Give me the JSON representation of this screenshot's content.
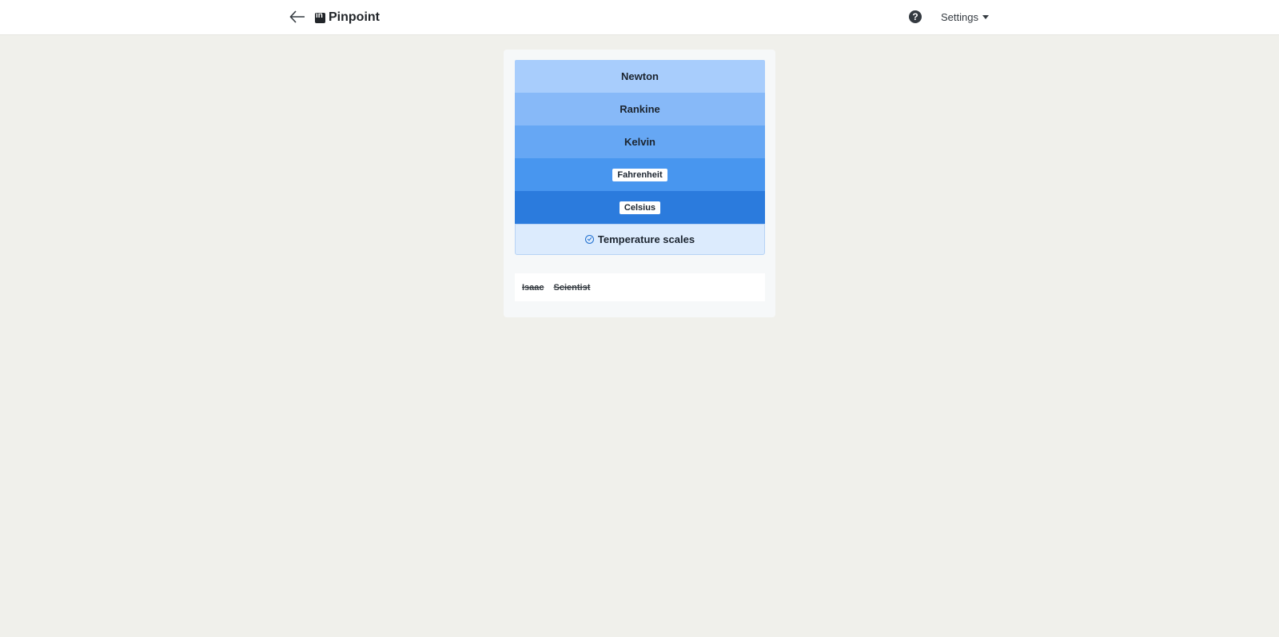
{
  "header": {
    "brand_name": "Pinpoint",
    "settings_label": "Settings",
    "icons": {
      "back": "arrow-left-icon",
      "logo": "linkedin-square-icon",
      "help": "question-circle-icon",
      "dropdown": "caret-down-icon"
    }
  },
  "puzzle": {
    "tiers": [
      {
        "label": "Newton",
        "tagged": false,
        "color": "#a8cdfc"
      },
      {
        "label": "Rankine",
        "tagged": false,
        "color": "#87b9f8"
      },
      {
        "label": "Kelvin",
        "tagged": false,
        "color": "#66a7f4"
      },
      {
        "label": "Fahrenheit",
        "tagged": true,
        "color": "#4896ef"
      },
      {
        "label": "Celsius",
        "tagged": true,
        "color": "#2b7bdd"
      }
    ],
    "category": {
      "label": "Temperature scales",
      "icon": "check-circle-icon",
      "background": "#dcebfd"
    },
    "guesses": [
      "Isaac",
      "Scientist"
    ]
  },
  "colors": {
    "page_background": "#f0f0eb",
    "panel_background": "#f6f8f9"
  }
}
